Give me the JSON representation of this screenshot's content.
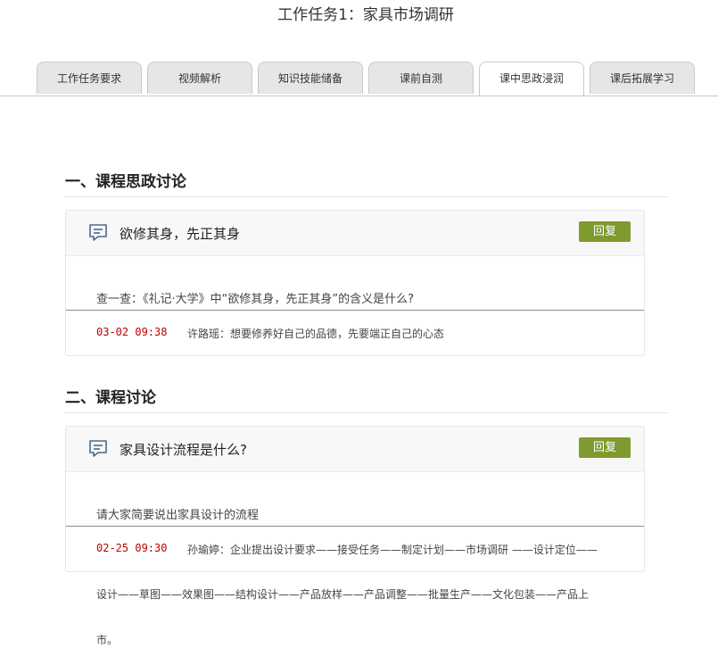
{
  "page_title": "工作任务1：家具市场调研",
  "tabs": [
    {
      "label": "工作任务要求"
    },
    {
      "label": "视频解析"
    },
    {
      "label": "知识技能储备"
    },
    {
      "label": "课前自测"
    },
    {
      "label": "课中思政浸润"
    },
    {
      "label": "课后拓展学习"
    }
  ],
  "active_tab": "课中思政浸润",
  "sections": [
    {
      "heading": "一、课程思政讨论",
      "card": {
        "icon": "chat-bubble-icon",
        "title": "欲修其身，先正其身",
        "reply_label": "回复",
        "question": "查一查：《礼记·大学》中“欲修其身，先正其身”的含义是什么?",
        "reply": {
          "time": "03-02 09:38",
          "text": "许路瑶：想要修养好自己的品德，先要端正自己的心态"
        }
      }
    },
    {
      "heading": "二、课程讨论",
      "card": {
        "icon": "chat-bubble-icon",
        "title": "家具设计流程是什么?",
        "reply_label": "回复",
        "question": "请大家简要说出家具设计的流程",
        "reply": {
          "time": "02-25 09:30",
          "text": "孙瑜婷：企业提出设计要求——接受任务——制定计划——市场调研 ——设计定位——",
          "continued_line1": "设计——草图——效果图——结构设计——产品放样——产品调整——批量生产——文化包装——产品上",
          "continued_line2": "市。"
        }
      }
    }
  ],
  "colors": {
    "reply_button": "#7f9b2f",
    "reply_time": "#c00000",
    "tab_inactive": "#e6e6e6",
    "icon": "#4a6b8a"
  }
}
